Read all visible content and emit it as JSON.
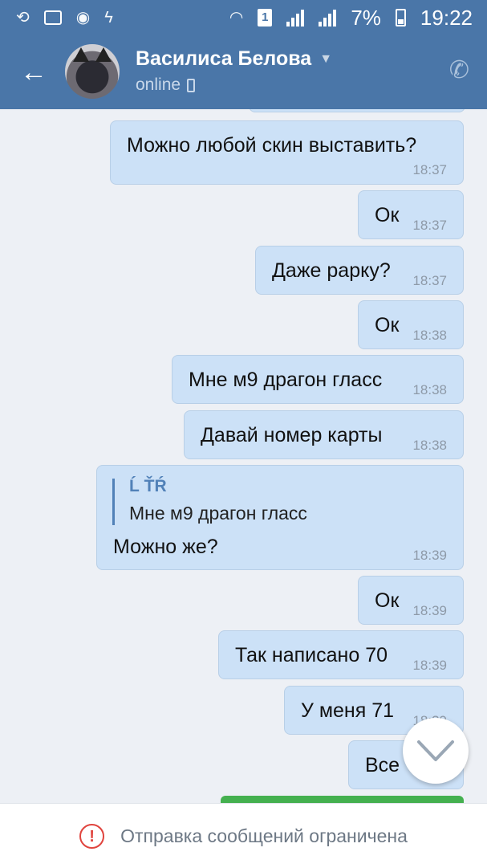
{
  "status_bar": {
    "battery_percent": "7%",
    "time": "19:22",
    "sim": "1",
    "icons": [
      "share-icon",
      "gallery-icon",
      "chrome-icon",
      "flash-icon",
      "wifi-icon",
      "sim-icon",
      "signal-icon",
      "signal-icon",
      "battery-charging-icon"
    ]
  },
  "header": {
    "contact_name": "Василиса Белова",
    "status": "online",
    "back_icon": "arrow-left-icon",
    "call_icon": "phone-icon",
    "mobile_icon": "mobile-icon"
  },
  "messages": [
    {
      "text": "Можно любой скин выставить?",
      "time": "18:37"
    },
    {
      "text": "Ок",
      "time": "18:37"
    },
    {
      "text": "Даже рарку?",
      "time": "18:37"
    },
    {
      "text": "Ок",
      "time": "18:38"
    },
    {
      "text": "Мне м9 драгон гласс",
      "time": "18:38"
    },
    {
      "text": "Давай номер карты",
      "time": "18:38"
    },
    {
      "quote_author": "Ĺ ŤŔ",
      "quote_text": "Мне м9 драгон гласс",
      "text": "Можно же?",
      "time": "18:39"
    },
    {
      "text": "Ок",
      "time": "18:39"
    },
    {
      "text": "Так написано 70",
      "time": "18:39"
    },
    {
      "text": "У меня 71",
      "time": "18:39"
    },
    {
      "text": "Все",
      "time": ""
    }
  ],
  "scroll_down_icon": "chevron-down-icon",
  "footer": {
    "notice": "Отправка сообщений ограничена",
    "icon": "warning-circle-icon",
    "accent_color": "#e0443e"
  },
  "colors": {
    "header": "#4a76a8",
    "bubble": "#cce1f7",
    "background": "#edf0f5"
  }
}
